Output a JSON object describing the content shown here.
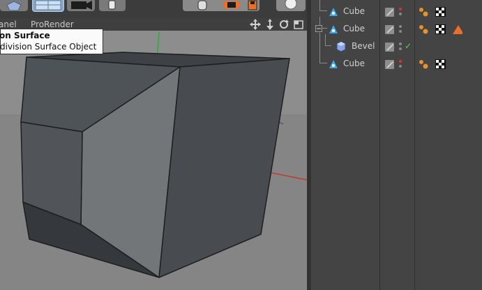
{
  "tooltip": {
    "title": "on Surface",
    "subtitle": "division Surface Object"
  },
  "viewport": {
    "menu_panel": "anel",
    "menu_prorender": "ProRender"
  },
  "objects": [
    {
      "name": "Cube",
      "tags": [
        "phong-tag",
        "checker-material-tag"
      ]
    },
    {
      "name": "Cube",
      "tags": [
        "phong-tag",
        "checker-material-tag",
        "warning-tag"
      ],
      "expanded": true
    },
    {
      "name": "Bevel",
      "child": true,
      "enabled": true
    },
    {
      "name": "Cube",
      "tags": [
        "phong-tag",
        "checker-material-tag"
      ]
    }
  ],
  "colors": {
    "accent_orange": "#e8702a",
    "enabled_check": "#4fd14f",
    "render_dot_red": "#e03030",
    "axis_red": "#c0392b",
    "axis_green": "#2faa3a"
  }
}
